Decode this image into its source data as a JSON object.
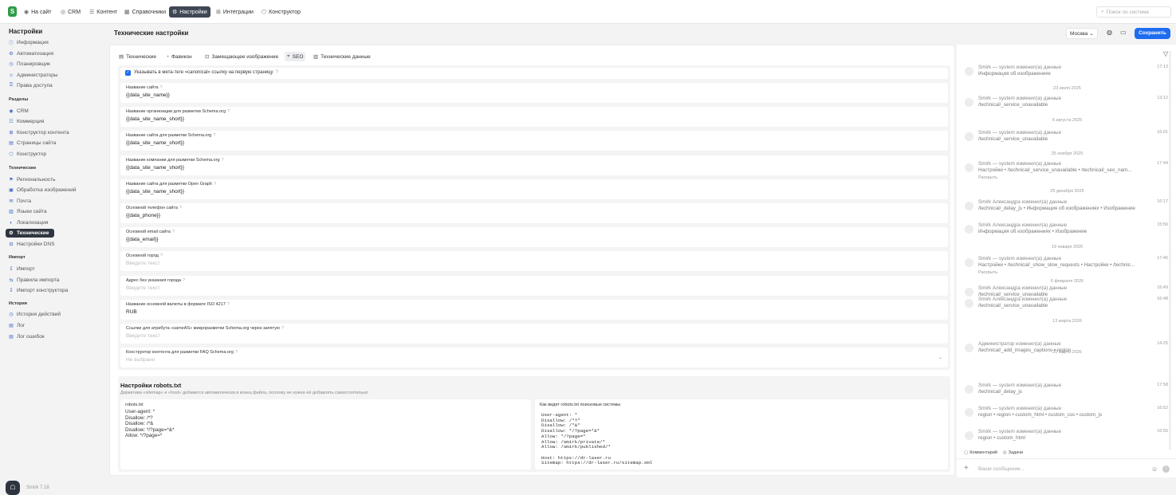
{
  "nav": {
    "tabs": [
      {
        "label": "На сайт",
        "icon": "site-icon"
      },
      {
        "label": "CRM",
        "icon": "crm-icon"
      },
      {
        "label": "Контент",
        "icon": "content-icon"
      },
      {
        "label": "Справочники",
        "icon": "catalog-icon"
      },
      {
        "label": "Настройки",
        "icon": "settings-icon",
        "active": true
      },
      {
        "label": "Интеграции",
        "icon": "integrations-icon"
      },
      {
        "label": "Конструктор",
        "icon": "constructor-icon"
      }
    ],
    "search_placeholder": "Поиск по системе"
  },
  "sidebar": {
    "title": "Настройки",
    "groups": [
      {
        "items": [
          "Информация",
          "Автоматизация",
          "Планировщик",
          "Администраторы",
          "Права доступа"
        ]
      },
      {
        "title": "Разделы",
        "items": [
          "CRM",
          "Коммерция",
          "Конструктор контента",
          "Страницы сайта",
          "Конструктор"
        ]
      },
      {
        "title": "Технические",
        "items": [
          "Региональность",
          "Обработка изображений",
          "Почта",
          "Языки сайта",
          "Локализация",
          "Технические",
          "Настройки DNS"
        ]
      },
      {
        "title": "Импорт",
        "items": [
          "Импорт",
          "Правила импорта",
          "Импорт конструктора"
        ]
      },
      {
        "title": "История",
        "items": [
          "История действий",
          "Лог",
          "Лог ошибок"
        ]
      }
    ],
    "active_item": "Технические",
    "version": "Smirk 7.18"
  },
  "page": {
    "title": "Технические настройки",
    "region": "Москва",
    "save_label": "Сохранить"
  },
  "settings_tabs": [
    {
      "label": "Технические",
      "active": false
    },
    {
      "label": "Фавикон",
      "active": false
    },
    {
      "label": "Замещающее изображение",
      "active": false
    },
    {
      "label": "SEO",
      "active": true
    },
    {
      "label": "Технические данные",
      "active": false
    }
  ],
  "seo": {
    "canonical_label": "Указывать в мета-теге «canonical» ссылку на первую страницу",
    "canonical_checked": true,
    "fields": [
      {
        "label": "Название сайта",
        "value": "{{data_site_name}}",
        "placeholder": false
      },
      {
        "label": "Название организации для разметки Schema.org",
        "value": "{{data_site_name_short}}",
        "placeholder": false
      },
      {
        "label": "Название сайта для разметки Schema.org",
        "value": "{{data_site_name_short}}",
        "placeholder": false
      },
      {
        "label": "Название компании для разметки Schema.org",
        "value": "{{data_site_name_short}}",
        "placeholder": false
      },
      {
        "label": "Название сайта для разметки Open Graph",
        "value": "{{data_site_name_short}}",
        "placeholder": false
      },
      {
        "label": "Основной телефон сайта",
        "value": "{{data_phone}}",
        "placeholder": false
      },
      {
        "label": "Основной email сайта",
        "value": "{{data_email}}",
        "placeholder": false
      },
      {
        "label": "Основной город",
        "value": "Введите текст",
        "placeholder": true
      },
      {
        "label": "Адрес без указания города",
        "value": "Введите текст",
        "placeholder": true
      },
      {
        "label": "Название основной валюты в формате ISO 4217",
        "value": "RUB",
        "placeholder": false
      },
      {
        "label": "Ссылки для атрибута «sameAS» микроразметки Schema.org через запятую",
        "value": "Введите текст",
        "placeholder": true
      },
      {
        "label": "Конструктор контента для разметки FAQ Schema.org",
        "value": "Не выбрано",
        "placeholder": true,
        "dropdown": true
      }
    ]
  },
  "robots": {
    "title": "Настройки robots.txt",
    "description": "Директива «sitemap» и «host» добавится автоматически в конец файла, поэтому не нужно её добавлять самостоятельно",
    "editor_label": "robots.txt",
    "editor_text": "User-agent: *\nDisallow: /*?\nDisallow: /*&\nDisallow: */?page=*&*\nAllow: */?page=*",
    "preview_label": "Как видят robots.txt поисковые системы",
    "preview_text": "User-agent: *\nDisallow: /*?*\nDisallow: /*&*\nDisallow: */?page=*&*\nAllow: */?page=*\nAllow: /smirk/private/*\nAllow: /smirk/published/*\n\nHost: https://dr-laser.ru\nSitemap: https://dr-laser.ru/sitemap.xml"
  },
  "history": {
    "entries": [
      {
        "type": "row",
        "l1": "Smirk — system изменил(а) данные",
        "l2": "Информация об изображениях",
        "time": "17:13"
      },
      {
        "type": "date",
        "text": "23 июля 2025"
      },
      {
        "type": "row",
        "l1": "Smirk — system изменил(а) данные",
        "l2": "/technical/_service_unavailable",
        "time": "13:12"
      },
      {
        "type": "date",
        "text": "6 августа 2025"
      },
      {
        "type": "row",
        "l1": "Smirk — system изменил(а) данные",
        "l2": "/technical/_service_unavailable",
        "time": "16:01"
      },
      {
        "type": "date",
        "text": "25 ноября 2025"
      },
      {
        "type": "row",
        "l1": "Smirk — system изменил(а) данные",
        "l2": "Настройки • /technical/_service_unavailable • /technical/_seo_nam...",
        "time": "17:44",
        "expand": "Раскрыть"
      },
      {
        "type": "date",
        "text": "25 декабря 2025"
      },
      {
        "type": "row",
        "l1": "Smirk Александра изменил(а) данные",
        "l2": "/technical/_delay_js • Информация об изображениях • Изображение",
        "time": "16:17"
      },
      {
        "type": "row",
        "l1": "Smirk Александра изменил(а) данные",
        "l2": "Информация об изображениях • Изображение",
        "time": "15:56"
      },
      {
        "type": "date",
        "text": "19 января 2026"
      },
      {
        "type": "row",
        "l1": "Smirk — system изменил(а) данные",
        "l2": "Настройки • /technical/_show_slow_requests • Настройки • /technic...",
        "time": "17:46",
        "expand": "Раскрыть"
      },
      {
        "type": "date",
        "text": "6 февраля 2026"
      },
      {
        "type": "row",
        "l1": "Smirk Александра изменил(а) данные",
        "l2": "/technical/_service_unavailable",
        "time": "16:49"
      },
      {
        "type": "row",
        "l1": "Smirk Александра изменил(а) данные",
        "l2": "/technical/_service_unavailable",
        "time": "16:48"
      },
      {
        "type": "date",
        "text": "13 марта 2026"
      },
      {
        "type": "row",
        "l1": "Администратор изменил(а) данные",
        "l2": "/technical/_add_images_captions • region",
        "time": "14:25"
      },
      {
        "type": "date",
        "text": "20 марта 2026"
      },
      {
        "type": "row",
        "l1": "Smirk — system изменил(а) данные",
        "l2": "/technical/_delay_js",
        "time": "17:58"
      },
      {
        "type": "row",
        "l1": "Smirk — system изменил(а) данные",
        "l2": "region • region • custom_html • custom_css • custom_js",
        "time": "16:52"
      },
      {
        "type": "row",
        "l1": "Smirk — system изменил(а) данные",
        "l2": "region • custom_html",
        "time": "16:55"
      }
    ],
    "tab_comments": "Комментарий",
    "tab_tasks": "Задачи",
    "message_placeholder": "Ваше сообщение..."
  }
}
